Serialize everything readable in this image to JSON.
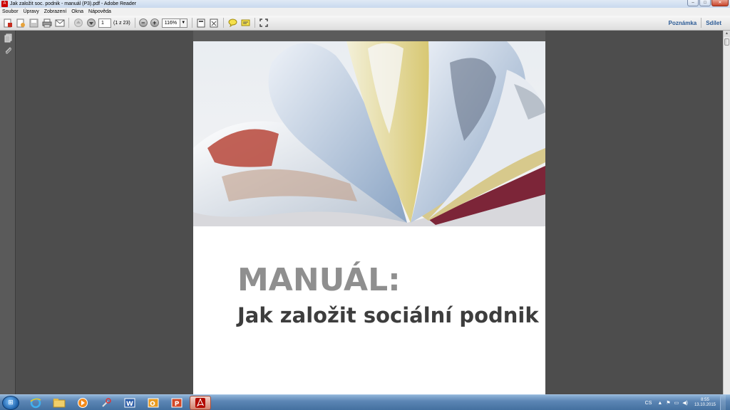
{
  "window": {
    "title": "Jak založit soc. podnik - manuál (P3).pdf - Adobe Reader",
    "controls": [
      "minimize",
      "maximize",
      "close"
    ]
  },
  "menu": {
    "items": [
      "Soubor",
      "Úpravy",
      "Zobrazení",
      "Okna",
      "Nápověda"
    ]
  },
  "toolbar": {
    "page_number": "1",
    "page_count": "(1 z 23)",
    "zoom": "116%",
    "right_buttons": [
      "Poznámka",
      "Sdílet"
    ],
    "icons": [
      "create-pdf-icon",
      "edit-icon",
      "save-icon",
      "print-icon",
      "email-icon",
      "prev-page-icon",
      "next-page-icon",
      "zoom-out-icon",
      "zoom-in-icon",
      "fit-page-icon",
      "fit-width-icon",
      "comment-icon",
      "highlight-icon",
      "expand-icon"
    ]
  },
  "left_panel": {
    "icons": [
      "pages-icon",
      "attachments-icon"
    ]
  },
  "document": {
    "title_line1": "MANUÁL:",
    "title_line2": "Jak založit sociální podnik",
    "colors": {
      "title_line1": "#8f8f8f",
      "title_line2": "#3d3d3d"
    }
  },
  "taskbar": {
    "items": [
      "start-orb-icon",
      "internet-explorer-icon",
      "file-explorer-icon",
      "media-player-icon",
      "tools-icon",
      "word-icon",
      "outlook-icon",
      "powerpoint-icon",
      "adobe-reader-icon"
    ],
    "tray": {
      "language": "CS",
      "time": "8:55",
      "date": "13.10.2015"
    }
  }
}
